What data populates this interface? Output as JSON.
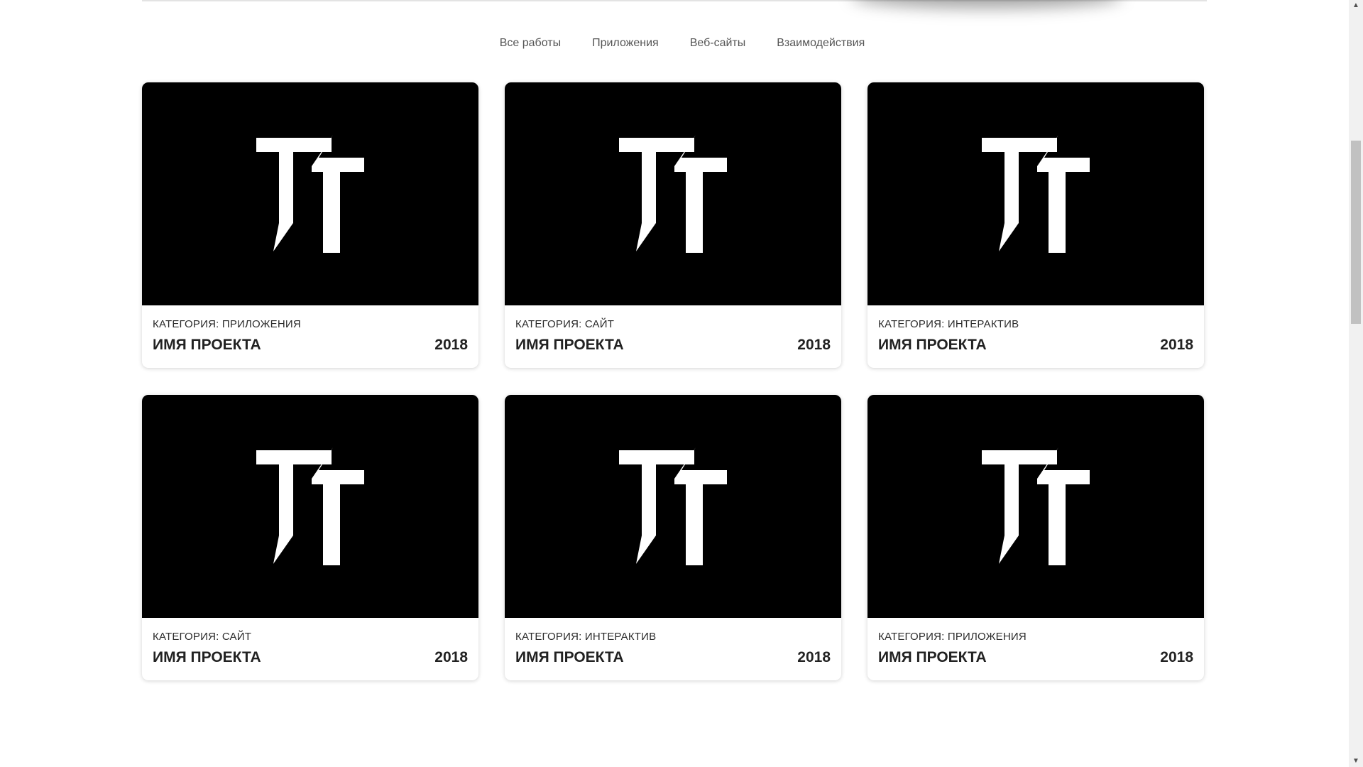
{
  "filters": [
    {
      "label": "Все работы"
    },
    {
      "label": "Приложения"
    },
    {
      "label": "Веб-сайты"
    },
    {
      "label": "Взаимодействия"
    }
  ],
  "projects": [
    {
      "category": "КАТЕГОРИЯ: ПРИЛОЖЕНИЯ",
      "name": "ИМЯ ПРОЕКТА",
      "year": "2018",
      "logo": "tt-logo-icon"
    },
    {
      "category": "КАТЕГОРИЯ: САЙТ",
      "name": "ИМЯ ПРОЕКТА",
      "year": "2018",
      "logo": "tt-logo-icon"
    },
    {
      "category": "КАТЕГОРИЯ: ИНТЕРАКТИВ",
      "name": "ИМЯ ПРОЕКТА",
      "year": "2018",
      "logo": "tt-logo-icon"
    },
    {
      "category": "КАТЕГОРИЯ: САЙТ",
      "name": "ИМЯ ПРОЕКТА",
      "year": "2018",
      "logo": "tt-logo-icon"
    },
    {
      "category": "КАТЕГОРИЯ: ИНТЕРАКТИВ",
      "name": "ИМЯ ПРОЕКТА",
      "year": "2018",
      "logo": "tt-logo-icon"
    },
    {
      "category": "КАТЕГОРИЯ: ПРИЛОЖЕНИЯ",
      "name": "ИМЯ ПРОЕКТА",
      "year": "2018",
      "logo": "tt-logo-icon"
    }
  ],
  "colors": {
    "card_image_bg": "#000000",
    "logo": "#ffffff",
    "text": "#222222",
    "filter_text": "#555555"
  },
  "scrollbar": {
    "up_icon": "scroll-up-arrow-icon",
    "down_icon": "scroll-down-arrow-icon"
  }
}
